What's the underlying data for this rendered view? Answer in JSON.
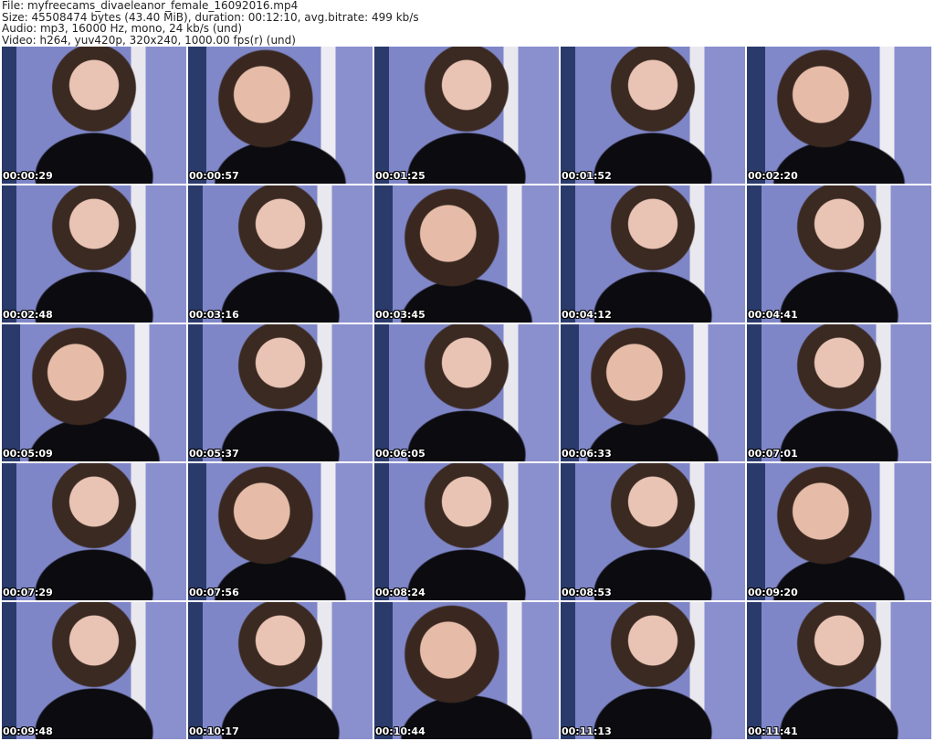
{
  "header": {
    "file": "File: myfreecams_divaeleanor_female_16092016.mp4",
    "size": "Size: 45508474 bytes (43.40 MiB), duration: 00:12:10, avg.bitrate: 499 kb/s",
    "audio": "Audio: mp3, 16000 Hz, mono, 24 kb/s (und)",
    "video": "Video: h264, yuv420p, 320x240, 1000.00 fps(r) (und)"
  },
  "thumbnails": [
    "00:00:29",
    "00:00:57",
    "00:01:25",
    "00:01:52",
    "00:02:20",
    "00:02:48",
    "00:03:16",
    "00:03:45",
    "00:04:12",
    "00:04:41",
    "00:05:09",
    "00:05:37",
    "00:06:05",
    "00:06:33",
    "00:07:01",
    "00:07:29",
    "00:07:56",
    "00:08:24",
    "00:08:53",
    "00:09:20",
    "00:09:48",
    "00:10:17",
    "00:10:44",
    "00:11:13",
    "00:11:41"
  ]
}
